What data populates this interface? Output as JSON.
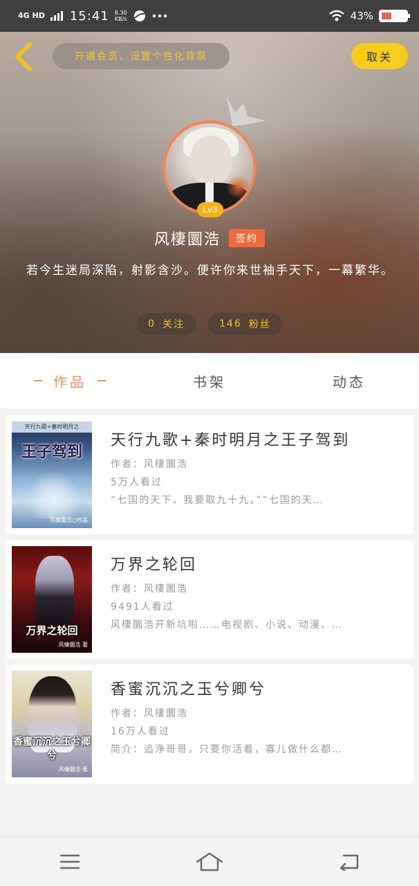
{
  "status_bar": {
    "network": "4G HD",
    "time": "15:41",
    "speed_value": "8.30",
    "speed_unit": "KB/s",
    "battery": "43%"
  },
  "header": {
    "vip_banner": "开通会员，设置个性化背景",
    "cancel_button": "取关",
    "level": "Lv3",
    "username": "风棲圜浩",
    "signed_badge": "签约",
    "bio": "若今生迷局深陷，射影含沙。便许你来世袖手天下，一幕繁华。",
    "following_count": "0",
    "following_label": "关注",
    "followers_count": "146",
    "followers_label": "粉丝"
  },
  "tabs": [
    {
      "label": "作品",
      "active": true
    },
    {
      "label": "书架",
      "active": false
    },
    {
      "label": "动态",
      "active": false
    }
  ],
  "books": [
    {
      "title": "天行九歌+秦时明月之王子驾到",
      "author": "作者：风棲圜浩",
      "views": "5万人看过",
      "summary": "“七国的天下，我要取九十九。”“七国的天…",
      "cover_title": "王子驾到",
      "cover_header": "天行九歌+秦时明月之",
      "cover_author": "风棲圜浩○作品"
    },
    {
      "title": "万界之轮回",
      "author": "作者：风棲圜浩",
      "views": "9491人看过",
      "summary": "风棲圜浩开新坑啦……电视剧、小说、动漫、…",
      "cover_title": "万界之轮回",
      "cover_author": "风棲圜浩 著"
    },
    {
      "title": "香蜜沉沉之玉兮卿兮",
      "author": "作者：风棲圜浩",
      "views": "16万人看过",
      "summary": "简介：追浄哥哥，只要你活着，寡儿做什么都…",
      "cover_title": "香蜜沉沉之玉兮卿兮",
      "cover_author": "风棲圜浩 著"
    }
  ],
  "colors": {
    "accent": "#ef8c5c",
    "yellow": "#f6cd1e",
    "signed": "#ef6b3d"
  },
  "icons": {
    "back": "chevron-left-icon",
    "menu": "menu-icon",
    "home": "home-icon",
    "return": "return-icon"
  }
}
